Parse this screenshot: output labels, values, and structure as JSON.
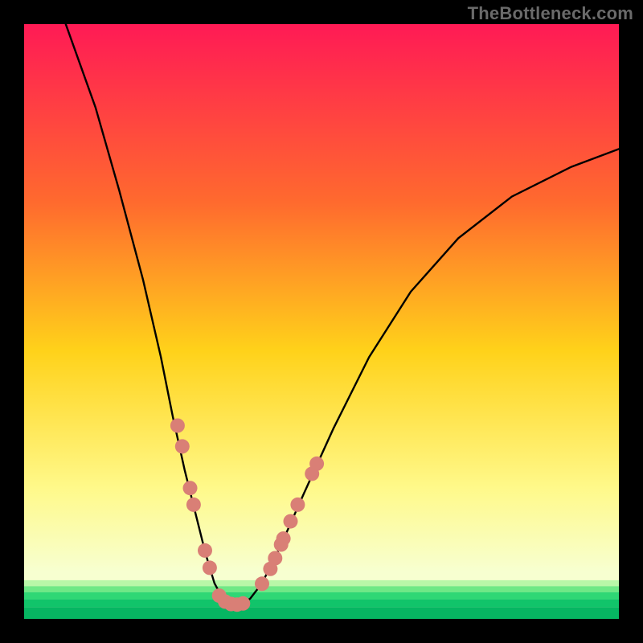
{
  "watermark": "TheBottleneck.com",
  "colors": {
    "frame": "#000000",
    "grad_top": "#ff1a55",
    "grad_mid1": "#ff6a2e",
    "grad_mid2": "#ffd21a",
    "grad_mid3": "#fff98a",
    "grad_low": "#f7ffd0",
    "green1": "#b9f7a8",
    "green2": "#6fe886",
    "green3": "#2fd775",
    "green4": "#11c46a",
    "green5": "#06b662",
    "curve": "#000000",
    "marker": "#d97f76"
  },
  "chart_data": {
    "type": "line",
    "title": "",
    "xlabel": "",
    "ylabel": "",
    "xlim": [
      0,
      100
    ],
    "ylim": [
      0,
      100
    ],
    "curve": {
      "name": "bottleneck-curve",
      "points": [
        [
          7,
          100
        ],
        [
          12,
          86
        ],
        [
          16,
          72
        ],
        [
          20,
          57
        ],
        [
          23,
          44
        ],
        [
          25,
          34
        ],
        [
          27,
          25
        ],
        [
          29,
          17
        ],
        [
          30.5,
          11
        ],
        [
          32,
          6
        ],
        [
          33.5,
          3.2
        ],
        [
          35,
          2.4
        ],
        [
          36.5,
          2.4
        ],
        [
          38,
          3.4
        ],
        [
          40,
          6
        ],
        [
          43,
          12
        ],
        [
          47,
          21
        ],
        [
          52,
          32
        ],
        [
          58,
          44
        ],
        [
          65,
          55
        ],
        [
          73,
          64
        ],
        [
          82,
          71
        ],
        [
          92,
          76
        ],
        [
          100,
          79
        ]
      ]
    },
    "markers": [
      [
        25.8,
        32.5
      ],
      [
        26.6,
        29.0
      ],
      [
        27.9,
        22.0
      ],
      [
        28.5,
        19.2
      ],
      [
        30.4,
        11.5
      ],
      [
        31.2,
        8.6
      ],
      [
        32.8,
        3.9
      ],
      [
        33.8,
        2.9
      ],
      [
        34.8,
        2.5
      ],
      [
        35.8,
        2.4
      ],
      [
        36.8,
        2.6
      ],
      [
        40.0,
        5.9
      ],
      [
        41.4,
        8.4
      ],
      [
        42.2,
        10.2
      ],
      [
        43.2,
        12.5
      ],
      [
        43.6,
        13.5
      ],
      [
        44.8,
        16.4
      ],
      [
        46.0,
        19.2
      ],
      [
        48.4,
        24.4
      ],
      [
        49.2,
        26.1
      ]
    ]
  }
}
